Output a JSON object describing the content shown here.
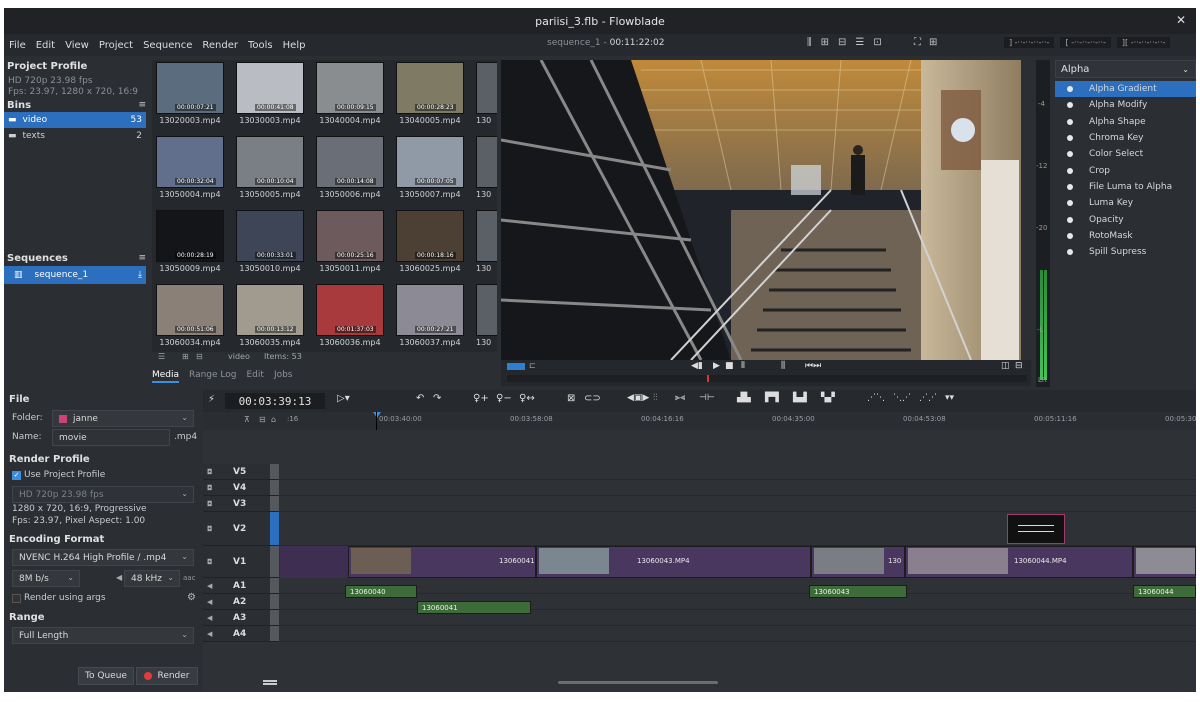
{
  "window": {
    "title": "pariisi_3.flb - Flowblade",
    "close_glyph": "✕"
  },
  "menu": [
    "File",
    "Edit",
    "View",
    "Project",
    "Sequence",
    "Render",
    "Tools",
    "Help"
  ],
  "sequence_info": {
    "name": "sequence_1",
    "separator": " - ",
    "timecode": "00:11:22:02"
  },
  "top_meters": [
    "]  -··-··-··-··-",
    "[  -··-··-··-··-",
    "][  -··-··-··-··-"
  ],
  "project": {
    "header": "Project Profile",
    "profile_name": "HD 720p 23.98 fps",
    "profile_detail": "Fps: 23.97, 1280 x 720, 16:9"
  },
  "bins": {
    "header": "Bins",
    "items": [
      {
        "name": "video",
        "count": "53"
      },
      {
        "name": "texts",
        "count": "2"
      }
    ]
  },
  "sequences": {
    "header": "Sequences",
    "items": [
      "sequence_1"
    ]
  },
  "media": {
    "items": [
      {
        "name": "13020003.mp4",
        "dur": "00:00:07:21",
        "color": "#5a6c7e"
      },
      {
        "name": "13030003.mp4",
        "dur": "00:00:41:08",
        "color": "#b9bcc2"
      },
      {
        "name": "13040004.mp4",
        "dur": "00:00:09:15",
        "color": "#8a8d8f"
      },
      {
        "name": "13040005.mp4",
        "dur": "00:00:28:23",
        "color": "#7f7a64"
      },
      {
        "name": "13050004.mp4",
        "dur": "00:00:32:04",
        "color": "#616f8c"
      },
      {
        "name": "13050005.mp4",
        "dur": "00:00:10:04",
        "color": "#7a7f86"
      },
      {
        "name": "13050006.mp4",
        "dur": "00:00:14:08",
        "color": "#6a6e76"
      },
      {
        "name": "13050007.mp4",
        "dur": "00:00:07:05",
        "color": "#8f9aa6"
      },
      {
        "name": "13050009.mp4",
        "dur": "00:00:28:19",
        "color": "#141518"
      },
      {
        "name": "13050010.mp4",
        "dur": "00:00:33:01",
        "color": "#3d4556"
      },
      {
        "name": "13050011.mp4",
        "dur": "00:00:25:16",
        "color": "#6d5a5c"
      },
      {
        "name": "13060025.mp4",
        "dur": "00:00:18:16",
        "color": "#4b4033"
      },
      {
        "name": "13060034.mp4",
        "dur": "00:00:51:06",
        "color": "#8b8078"
      },
      {
        "name": "13060035.mp4",
        "dur": "00:00:13:12",
        "color": "#a19a8e"
      },
      {
        "name": "13060036.mp4",
        "dur": "00:01:37:03",
        "color": "#a8393c"
      },
      {
        "name": "13060037.mp4",
        "dur": "00:00:27:21",
        "color": "#8c8a94"
      }
    ],
    "partial_label": "130",
    "footer_bin": "video",
    "footer_items": "Items: 53"
  },
  "media_tabs": [
    "Media",
    "Range Log",
    "Edit",
    "Jobs"
  ],
  "meter_labels": [
    "-4",
    "-12",
    "-20",
    "-L",
    "LR"
  ],
  "effects": {
    "category": "Alpha",
    "items": [
      "Alpha Gradient",
      "Alpha Modify",
      "Alpha Shape",
      "Chroma Key",
      "Color Select",
      "Crop",
      "File Luma to Alpha",
      "Luma Key",
      "Opacity",
      "RotoMask",
      "Spill Supress"
    ]
  },
  "render": {
    "file_header": "File",
    "folder_label": "Folder:",
    "folder_value": "janne",
    "name_label": "Name:",
    "name_value": "movie",
    "extension": ".mp4",
    "profile_header": "Render Profile",
    "use_project_profile": "Use Project Profile",
    "profile_value": "HD 720p 23.98 fps",
    "profile_info1": "1280 x 720, 16:9, Progressive",
    "profile_info2": "Fps: 23.97, Pixel Aspect: 1.00",
    "encoding_header": "Encoding Format",
    "encoding_value": "NVENC H.264 High Profile / .mp4",
    "bitrate": "8M b/s",
    "audio_rate": "48 kHz",
    "audio_codec": "aac",
    "render_args": "Render using args",
    "range_header": "Range",
    "range_value": "Full Length",
    "to_queue": "To Queue",
    "render_button": "Render"
  },
  "timeline": {
    "timecode": "00:03:39:13",
    "ruler_marks": [
      ":16",
      "00:03:40:00",
      "00:03:58:08",
      "00:04:16:16",
      "00:04:35:00",
      "00:04:53:08",
      "00:05:11:16",
      "00:05:30"
    ],
    "tracks": [
      "V5",
      "V4",
      "V3",
      "V2",
      "V1",
      "A1",
      "A2",
      "A3",
      "A4"
    ],
    "clips": {
      "v1a": "13060041",
      "v1b": "13060043.MP4",
      "v1c": "130",
      "v1d": "13060044.MP4",
      "a1a": "13060040",
      "a1b": "13060043",
      "a1c": "13060044",
      "a2a": "13060041"
    }
  }
}
